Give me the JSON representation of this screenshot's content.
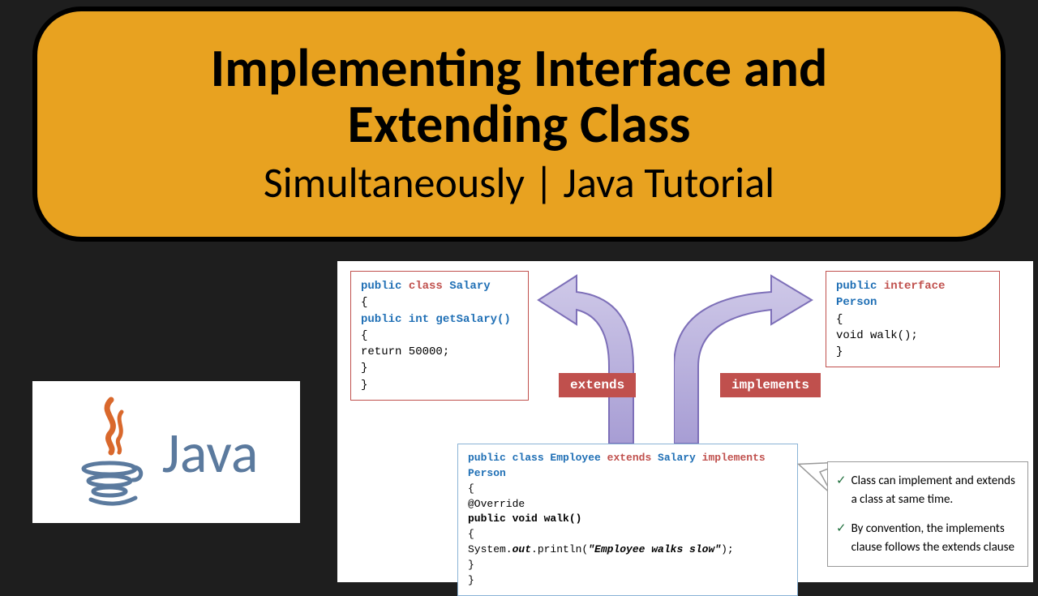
{
  "title": {
    "line1": "Implementing Interface and",
    "line2": "Extending Class",
    "subtitle": "Simultaneously | Java Tutorial"
  },
  "logo": {
    "text": "Java"
  },
  "diagram": {
    "salary": {
      "l1a": "public ",
      "l1b": "class",
      "l1c": " Salary",
      "l2": "{",
      "l3": "     public int getSalary()",
      "l4": "     {",
      "l5": "       return 50000;",
      "l6": "     }",
      "l7": "}"
    },
    "person": {
      "l1a": "public ",
      "l1b": "interface",
      "l1c": " Person",
      "l2": "{",
      "l3": "   void walk();",
      "l4": "}"
    },
    "badges": {
      "extends": "extends",
      "implements": "implements"
    },
    "employee": {
      "l1a": "public class Employee ",
      "l1b": "extends",
      "l1c": " Salary ",
      "l1d": "implements",
      "l1e": " Person",
      "l2": "{",
      "l3": "        @Override",
      "l4": "        public void walk()",
      "l5": "        {",
      "l6a": "          System.",
      "l6b": "out",
      "l6c": ".println(",
      "l6d": "\"Employee walks slow\"",
      "l6e": ");",
      "l7": "        }",
      "l8": "}"
    },
    "callout": {
      "c1": "Class can implement and extends a class at same time.",
      "c2": "By convention, the implements clause follows the extends clause"
    }
  }
}
